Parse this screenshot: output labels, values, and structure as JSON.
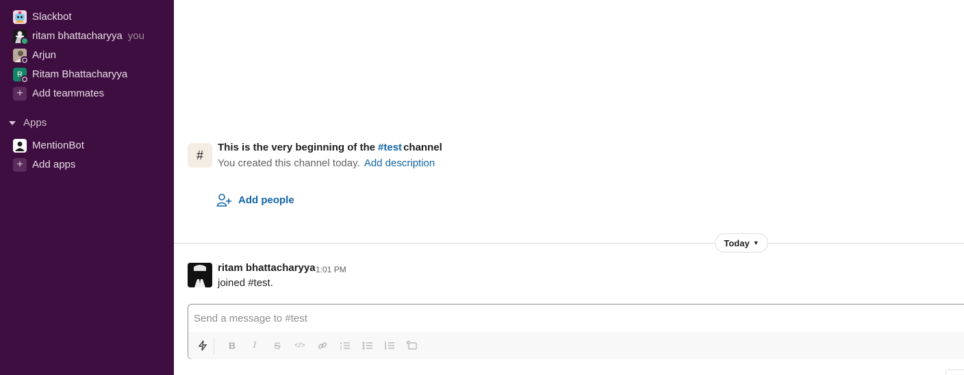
{
  "sidebar": {
    "direct_messages": [
      {
        "name": "Slackbot",
        "avatar": "slackbot-avatar",
        "suffix": ""
      },
      {
        "name": "ritam bhattacharyya",
        "avatar": "user-avatar",
        "suffix": "you",
        "presence": "online"
      },
      {
        "name": "Arjun",
        "avatar": "user-avatar",
        "suffix": "",
        "presence": "away"
      },
      {
        "name": "Ritam Bhattacharyya",
        "avatar": "initial-avatar",
        "initial": "R",
        "suffix": "",
        "presence": "away"
      }
    ],
    "add_teammates_label": "Add teammates",
    "apps_section_label": "Apps",
    "apps": [
      {
        "name": "MentionBot",
        "avatar": "bot-avatar"
      }
    ],
    "add_apps_label": "Add apps"
  },
  "channel_intro": {
    "title_prefix": "This is the very beginning of the",
    "channel_name": "#test",
    "title_suffix": "channel",
    "subtitle": "You created this channel today.",
    "add_description_label": "Add description",
    "add_people_label": "Add people"
  },
  "day_divider": {
    "label": "Today"
  },
  "messages": [
    {
      "author": "ritam bhattacharyya",
      "time": "1:01 PM",
      "text": "joined #test."
    }
  ],
  "composer": {
    "placeholder": "Send a message to #test",
    "toolbar": [
      "shortcuts-icon",
      "bold-icon",
      "italic-icon",
      "strikethrough-icon",
      "code-icon",
      "link-icon",
      "ordered-list-icon",
      "bulleted-list-icon",
      "blockquote-icon",
      "code-block-icon"
    ]
  },
  "colors": {
    "sidebar_bg": "#3f0e40",
    "link": "#1264a3",
    "presence_online": "#2bac76",
    "initial_avatar": "#148567"
  }
}
